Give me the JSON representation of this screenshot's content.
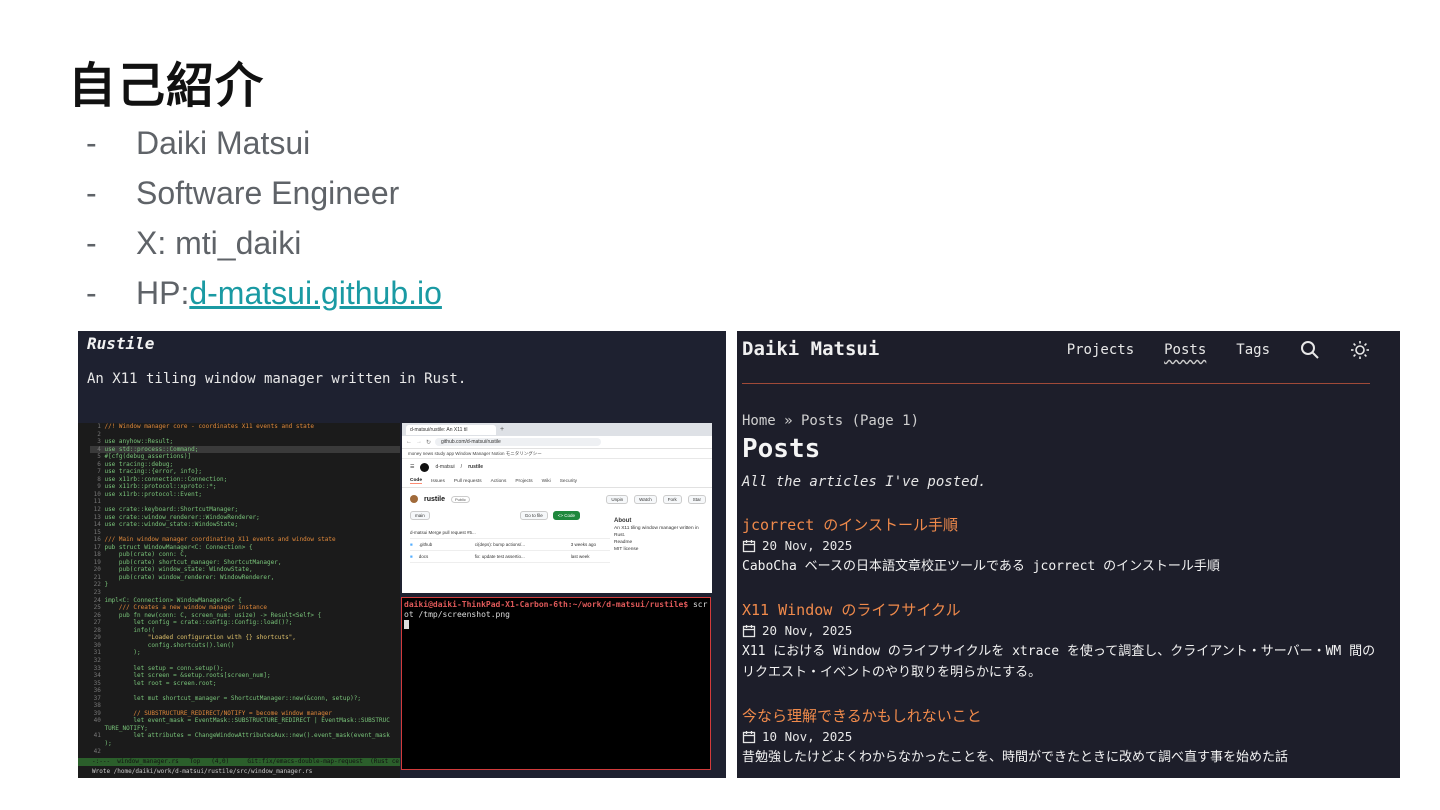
{
  "slide": {
    "title": "自己紹介",
    "bullets": [
      {
        "dash": "-",
        "text": "Daiki Matsui"
      },
      {
        "dash": "-",
        "text": "Software Engineer"
      },
      {
        "dash": "-",
        "text": "X: mti_daiki"
      },
      {
        "dash": "-",
        "prefix": "HP: ",
        "link": "d-matsui.github.io"
      }
    ]
  },
  "rustile": {
    "title": "Rustile",
    "description": "An X11 tiling window manager written in Rust.",
    "editor": {
      "lines": [
        {
          "n": "1",
          "t": "//! Window manager core - coordinates X11 events and state",
          "k": "cmt"
        },
        {
          "n": "2",
          "t": ""
        },
        {
          "n": "3",
          "t": "use anyhow::Result;"
        },
        {
          "n": "4",
          "t": "use std::process::Command;",
          "k": "hl"
        },
        {
          "n": "5",
          "t": "#[cfg(debug_assertions)]"
        },
        {
          "n": "6",
          "t": "use tracing::debug;"
        },
        {
          "n": "7",
          "t": "use tracing::{error, info};"
        },
        {
          "n": "8",
          "t": "use x11rb::connection::Connection;"
        },
        {
          "n": "9",
          "t": "use x11rb::protocol::xproto::*;"
        },
        {
          "n": "10",
          "t": "use x11rb::protocol::Event;"
        },
        {
          "n": "11",
          "t": ""
        },
        {
          "n": "12",
          "t": "use crate::keyboard::ShortcutManager;"
        },
        {
          "n": "13",
          "t": "use crate::window_renderer::WindowRenderer;"
        },
        {
          "n": "14",
          "t": "use crate::window_state::WindowState;"
        },
        {
          "n": "15",
          "t": ""
        },
        {
          "n": "16",
          "t": "/// Main window manager coordinating X11 events and window state",
          "k": "cmt"
        },
        {
          "n": "17",
          "t": "pub struct WindowManager<C: Connection> {"
        },
        {
          "n": "18",
          "t": "    pub(crate) conn: C,"
        },
        {
          "n": "19",
          "t": "    pub(crate) shortcut_manager: ShortcutManager,"
        },
        {
          "n": "20",
          "t": "    pub(crate) window_state: WindowState,"
        },
        {
          "n": "21",
          "t": "    pub(crate) window_renderer: WindowRenderer,"
        },
        {
          "n": "22",
          "t": "}"
        },
        {
          "n": "23",
          "t": ""
        },
        {
          "n": "24",
          "t": "impl<C: Connection> WindowManager<C> {"
        },
        {
          "n": "25",
          "t": "    /// Creates a new window manager instance",
          "k": "cmt"
        },
        {
          "n": "26",
          "t": "    pub fn new(conn: C, screen_num: usize) -> Result<Self> {"
        },
        {
          "n": "27",
          "t": "        let config = crate::config::Config::load()?;"
        },
        {
          "n": "28",
          "t": "        info!("
        },
        {
          "n": "29",
          "t": "            \"Loaded configuration with {} shortcuts\",",
          "k": "str"
        },
        {
          "n": "30",
          "t": "            config.shortcuts().len()"
        },
        {
          "n": "31",
          "t": "        );"
        },
        {
          "n": "32",
          "t": ""
        },
        {
          "n": "33",
          "t": "        let setup = conn.setup();"
        },
        {
          "n": "34",
          "t": "        let screen = &setup.roots[screen_num];"
        },
        {
          "n": "35",
          "t": "        let root = screen.root;"
        },
        {
          "n": "36",
          "t": ""
        },
        {
          "n": "37",
          "t": "        let mut shortcut_manager = ShortcutManager::new(&conn, setup)?;"
        },
        {
          "n": "38",
          "t": ""
        },
        {
          "n": "39",
          "t": "        // SUBSTRUCTURE_REDIRECT/NOTIFY = become window manager",
          "k": "cmt"
        },
        {
          "n": "40",
          "t": "        let event_mask = EventMask::SUBSTRUCTURE_REDIRECT | EventMask::SUBSTRUC"
        },
        {
          "n": "",
          "t": "TURE_NOTIFY;"
        },
        {
          "n": "41",
          "t": "        let attributes = ChangeWindowAttributesAux::new().event_mask(event_mask"
        },
        {
          "n": "",
          "t": ");"
        },
        {
          "n": "42",
          "t": ""
        }
      ],
      "modeline": "-:---  window_manager.rs   Top   (4,0)     Git:fix/emacs-double-map-request  (Rust ce",
      "minibuffer": "Wrote /home/daiki/work/d-matsui/rustile/src/window_manager.rs"
    },
    "browser": {
      "tab": "d-matsui/rustile: An X11 til",
      "url": "github.com/d-matsui/rustile",
      "bookmarks": "money  news  study  app  Window Manager  Notion  モニタリングシー",
      "owner": "d-matsui",
      "repo": "rustile",
      "nav": [
        "Code",
        "Issues",
        "Pull requests",
        "Actions",
        "Projects",
        "Wiki",
        "Security"
      ],
      "visibility": "Public",
      "buttons": [
        "Unpin",
        "Watch",
        "Fork",
        "Star"
      ],
      "branch": "main",
      "goto": "Go to file",
      "code_btn": "<> Code",
      "commit": "d-matsui  Merge pull request #5...",
      "files": [
        {
          "name": ".github",
          "msg": "ci(deps): bump actions/...",
          "when": "3 weeks ago"
        },
        {
          "name": "docs",
          "msg": "fix: update test assertio...",
          "when": "last week"
        }
      ],
      "about_title": "About",
      "about_text": "An X11 tiling window manager written in Rust.",
      "about_links": [
        "Readme",
        "MIT license"
      ]
    },
    "terminal": {
      "prompt": "daiki@daiki-ThinkPad-X1-Carbon-6th:~/work/d-matsui/rustile$",
      "cmd": " scr",
      "cont": "ot /tmp/screenshot.png"
    }
  },
  "blog": {
    "brand": "Daiki Matsui",
    "nav": [
      "Projects",
      "Posts",
      "Tags"
    ],
    "breadcrumb": "Home » Posts (Page 1)",
    "heading": "Posts",
    "subtitle": "All the articles I've posted.",
    "posts": [
      {
        "title": "jcorrect のインストール手順",
        "date": "20 Nov, 2025",
        "excerpt": "CaboCha ベースの日本語文章校正ツールである jcorrect のインストール手順"
      },
      {
        "title": "X11 Window のライフサイクル",
        "date": "20 Nov, 2025",
        "excerpt": "X11 における Window のライフサイクルを xtrace を使って調査し、クライアント・サーバー・WM 間のリクエスト・イベントのやり取りを明らかにする。"
      },
      {
        "title": "今なら理解できるかもしれないこと",
        "date": "10 Nov, 2025",
        "excerpt": "昔勉強したけどよくわからなかったことを、時間ができたときに改めて調べ直す事を始めた話"
      }
    ],
    "icons": [
      "search-icon",
      "sun-icon",
      "calendar-icon"
    ],
    "colors": {
      "accent": "#f08a4b",
      "background": "#1d1e2a"
    }
  }
}
